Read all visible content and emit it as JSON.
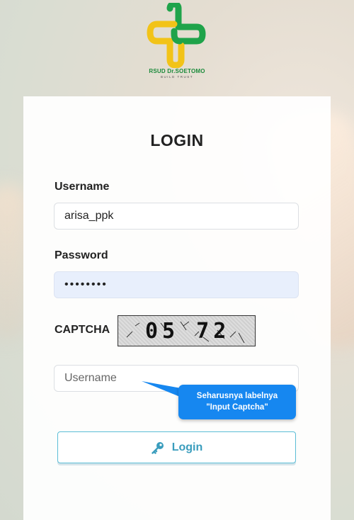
{
  "logo": {
    "brand": "RSUD Dr.SOETOMO",
    "tagline": "BUILD TRUST",
    "icon": "rsud-logo-icon",
    "colors": {
      "green": "#1fa34a",
      "yellow": "#f2c318"
    }
  },
  "form": {
    "title": "LOGIN",
    "username_label": "Username",
    "username_value": "arisa_ppk",
    "password_label": "Password",
    "password_value": "••••••••",
    "captcha_label": "CAPTCHA",
    "captcha_text": "05 72",
    "captcha_input_placeholder": "Username",
    "login_label": "Login",
    "login_icon": "key-icon"
  },
  "annotation": {
    "line1": "Seharusnya labelnya",
    "line2": "\"Input Captcha\"",
    "color": "#1687f0"
  }
}
